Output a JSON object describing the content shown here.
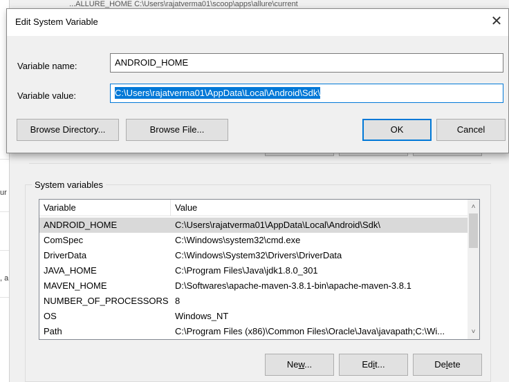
{
  "background": {
    "top_fragment": "...ALLURE_HOME        C:\\Users\\rajatverma01\\scoop\\apps\\allure\\current",
    "left_fragments": [
      "ur s",
      ", ar"
    ],
    "system_variables": {
      "title": "System variables",
      "columns": [
        "Variable",
        "Value"
      ],
      "rows": [
        {
          "name": "ANDROID_HOME",
          "value": "C:\\Users\\rajatverma01\\AppData\\Local\\Android\\Sdk\\",
          "selected": true
        },
        {
          "name": "ComSpec",
          "value": "C:\\Windows\\system32\\cmd.exe"
        },
        {
          "name": "DriverData",
          "value": "C:\\Windows\\System32\\Drivers\\DriverData"
        },
        {
          "name": "JAVA_HOME",
          "value": "C:\\Program Files\\Java\\jdk1.8.0_301"
        },
        {
          "name": "MAVEN_HOME",
          "value": "D:\\Softwares\\apache-maven-3.8.1-bin\\apache-maven-3.8.1"
        },
        {
          "name": "NUMBER_OF_PROCESSORS",
          "value": "8"
        },
        {
          "name": "OS",
          "value": "Windows_NT"
        },
        {
          "name": "Path",
          "value": "C:\\Program Files (x86)\\Common Files\\Oracle\\Java\\javapath;C:\\Wi..."
        }
      ],
      "buttons": {
        "new": {
          "pre": "Ne",
          "accel": "w",
          "post": "..."
        },
        "edit": {
          "pre": "Ed",
          "accel": "i",
          "post": "t..."
        },
        "delete": {
          "pre": "De",
          "accel": "l",
          "post": "ete"
        }
      }
    }
  },
  "dialog": {
    "title": "Edit System Variable",
    "close_glyph": "✕",
    "name_label": "Variable name:",
    "name_value": "ANDROID_HOME",
    "value_label": "Variable value:",
    "value_value": "C:\\Users\\rajatverma01\\AppData\\Local\\Android\\Sdk\\",
    "buttons": {
      "browse_directory": "Browse Directory...",
      "browse_file": "Browse File...",
      "ok": "OK",
      "cancel": "Cancel"
    }
  },
  "colors": {
    "accent": "#0078d7",
    "selection_row": "#d9d9d9",
    "window_bg": "#f0f0f0"
  }
}
